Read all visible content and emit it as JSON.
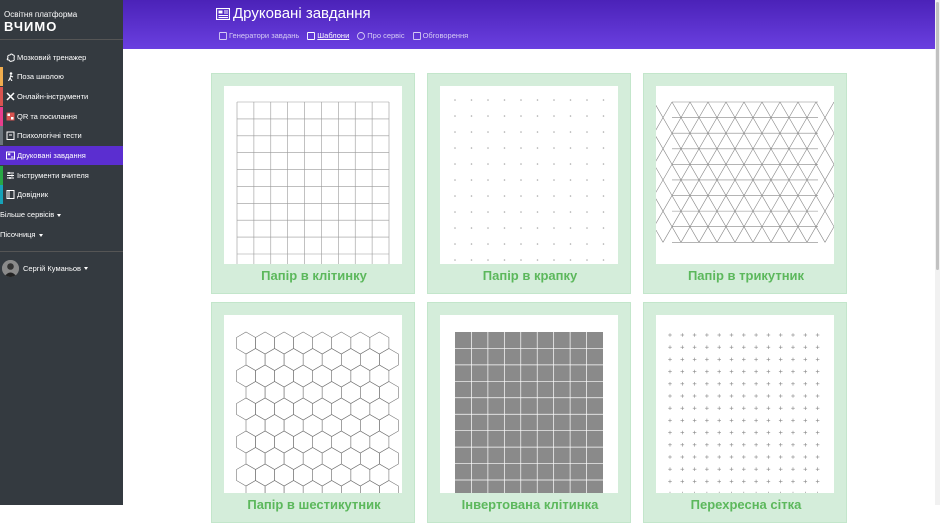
{
  "brand": {
    "subtitle": "Освітня платформа",
    "logo": "ВЧИМО"
  },
  "sidebar": {
    "items": [
      {
        "label": "Мозковий тренажер",
        "icon": "brain-icon",
        "bar": ""
      },
      {
        "label": "Поза школою",
        "icon": "walking-person-icon",
        "bar": "#f0ad4e"
      },
      {
        "label": "Онлайн-інструменти",
        "icon": "tools-icon",
        "bar": "#d9534f"
      },
      {
        "label": "QR та посилання",
        "icon": "qr-icon",
        "bar": "#e83e8c"
      },
      {
        "label": "Психологічні тести",
        "icon": "clipboard-icon",
        "bar": "#6c757d"
      },
      {
        "label": "Друковані завдання",
        "icon": "printed-tasks-icon",
        "bar": "#5b2ed0",
        "active": true
      },
      {
        "label": "Інструменти вчителя",
        "icon": "sliders-icon",
        "bar": "#28a745"
      },
      {
        "label": "Довідник",
        "icon": "book-icon",
        "bar": "#17a2b8"
      }
    ],
    "more": "Більше сервісів",
    "sandbox": "Пісочниця",
    "user": "Сергій Куманьов"
  },
  "header": {
    "title": "Друковані завдання",
    "tabs": [
      {
        "label": "Генератори завдань",
        "icon": "generator-icon"
      },
      {
        "label": "Шаблони",
        "icon": "file-icon",
        "active": true
      },
      {
        "label": "Про сервіс",
        "icon": "info-icon"
      },
      {
        "label": "Обговорення",
        "icon": "chat-icon"
      }
    ]
  },
  "templates": [
    {
      "label": "Папір в клітинку",
      "pattern": "grid"
    },
    {
      "label": "Папір в крапку",
      "pattern": "dots"
    },
    {
      "label": "Папір в трикутник",
      "pattern": "triangles"
    },
    {
      "label": "Папір в шестикутник",
      "pattern": "hexagons"
    },
    {
      "label": "Інвертована клітинка",
      "pattern": "inverted-grid"
    },
    {
      "label": "Перехресна сітка",
      "pattern": "crosses"
    }
  ],
  "colors": {
    "sidebar": "#343a40",
    "accent": "#5b2ed0",
    "card_bg": "#d4edda",
    "card_label": "#5cb85c"
  }
}
